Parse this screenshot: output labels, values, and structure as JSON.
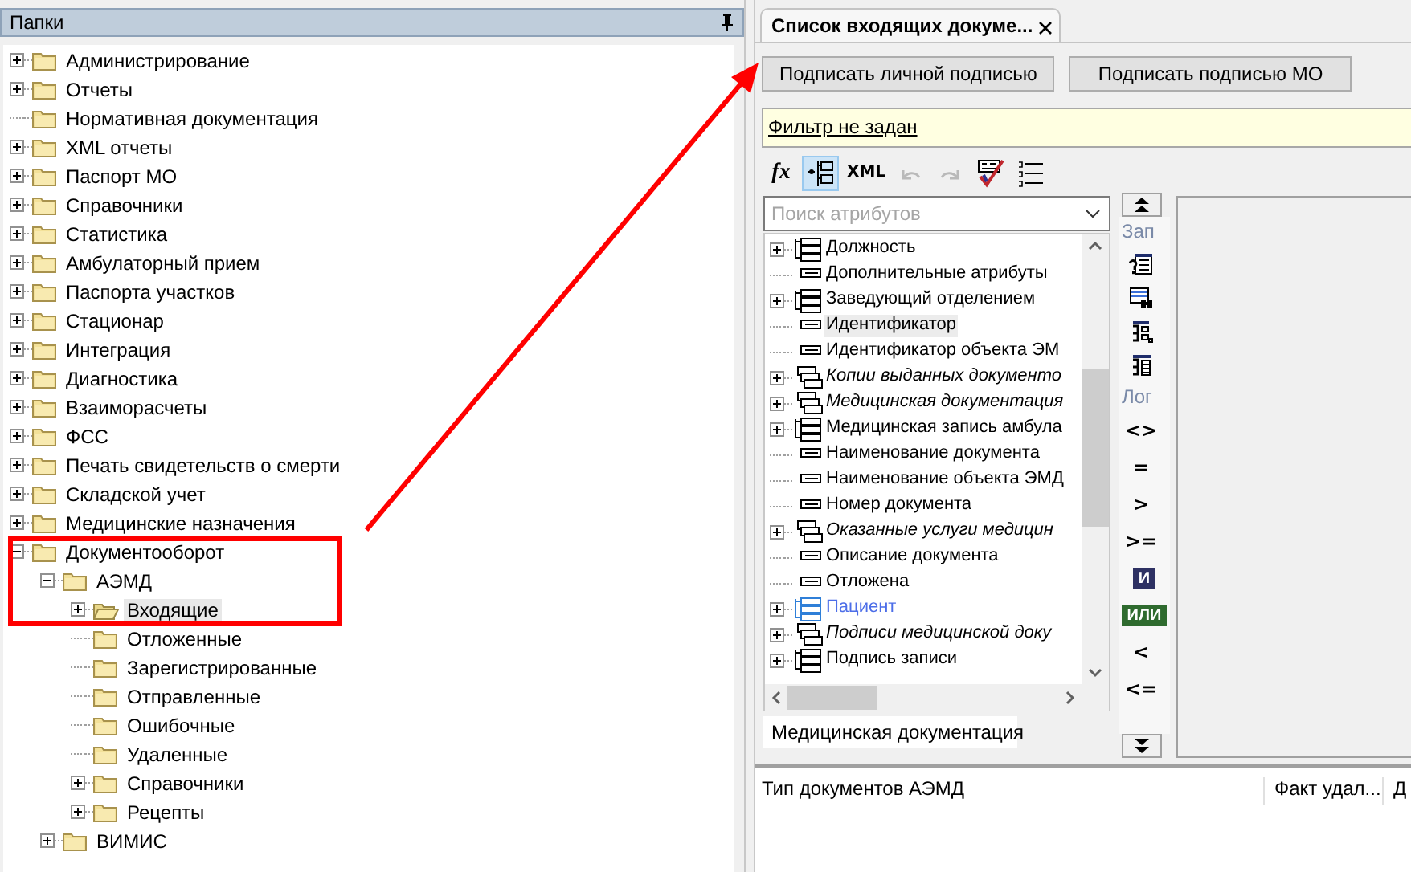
{
  "folders_panel": {
    "title": "Папки",
    "tree": [
      {
        "label": "Администрирование",
        "kind": "branch",
        "expanded": false,
        "selected": false
      },
      {
        "label": "Отчеты",
        "kind": "branch",
        "expanded": false,
        "selected": false
      },
      {
        "label": "Нормативная документация",
        "kind": "leaf",
        "selected": false
      },
      {
        "label": "XML отчеты",
        "kind": "branch",
        "expanded": false,
        "selected": false
      },
      {
        "label": "Паспорт МО",
        "kind": "branch",
        "expanded": false,
        "selected": false
      },
      {
        "label": "Справочники",
        "kind": "branch",
        "expanded": false,
        "selected": false
      },
      {
        "label": "Статистика",
        "kind": "branch",
        "expanded": false,
        "selected": false
      },
      {
        "label": "Амбулаторный прием",
        "kind": "branch",
        "expanded": false,
        "selected": false
      },
      {
        "label": "Паспорта участков",
        "kind": "branch",
        "expanded": false,
        "selected": false
      },
      {
        "label": "Стационар",
        "kind": "branch",
        "expanded": false,
        "selected": false
      },
      {
        "label": "Интеграция",
        "kind": "branch",
        "expanded": false,
        "selected": false
      },
      {
        "label": "Диагностика",
        "kind": "branch",
        "expanded": false,
        "selected": false
      },
      {
        "label": "Взаиморасчеты",
        "kind": "branch",
        "expanded": false,
        "selected": false
      },
      {
        "label": "ФСС",
        "kind": "branch",
        "expanded": false,
        "selected": false
      },
      {
        "label": "Печать свидетельств о смерти",
        "kind": "branch",
        "expanded": false,
        "selected": false
      },
      {
        "label": "Складской учет",
        "kind": "branch",
        "expanded": false,
        "selected": false
      },
      {
        "label": "Медицинские назначения",
        "kind": "branch",
        "expanded": false,
        "selected": false
      },
      {
        "label": "Документооборот",
        "kind": "branch",
        "expanded": true,
        "selected": false,
        "children": [
          {
            "label": "АЭМД",
            "kind": "branch",
            "expanded": true,
            "selected": false,
            "children": [
              {
                "label": "Входящие",
                "kind": "branch",
                "expanded": false,
                "selected": true
              },
              {
                "label": "Отложенные",
                "kind": "leaf",
                "selected": false
              },
              {
                "label": "Зарегистрированные",
                "kind": "leaf",
                "selected": false
              },
              {
                "label": "Отправленные",
                "kind": "leaf",
                "selected": false
              },
              {
                "label": "Ошибочные",
                "kind": "leaf",
                "selected": false
              },
              {
                "label": "Удаленные",
                "kind": "leaf",
                "selected": false
              },
              {
                "label": "Справочники",
                "kind": "branch",
                "expanded": false,
                "selected": false
              },
              {
                "label": "Рецепты",
                "kind": "branch",
                "expanded": false,
                "selected": false
              }
            ]
          },
          {
            "label": "ВИМИС",
            "kind": "branch",
            "expanded": false,
            "selected": false
          }
        ]
      }
    ]
  },
  "document_tab": {
    "title": "Список входящих докуме...",
    "selected": true
  },
  "buttons": [
    "Подписать личной подписью",
    "Подписать подписью МО"
  ],
  "filter": {
    "link": "Фильтр не задан"
  },
  "toolbar": [
    {
      "kind": "formula",
      "label": "fx"
    },
    {
      "kind": "tree",
      "selected": true
    },
    {
      "kind": "xml",
      "label": "XML"
    },
    {
      "kind": "undo",
      "disabled": true
    },
    {
      "kind": "redo",
      "disabled": true
    },
    {
      "kind": "check"
    },
    {
      "kind": "list"
    }
  ],
  "attribute_search": {
    "placeholder": "Поиск атрибутов"
  },
  "attributes": [
    {
      "label": "Должность",
      "kind": "group",
      "expandable": true,
      "selected": false
    },
    {
      "label": "Дополнительные атрибуты",
      "kind": "field",
      "expandable": false,
      "selected": false
    },
    {
      "label": "Заведующий отделением",
      "kind": "group",
      "expandable": true,
      "selected": false
    },
    {
      "label": "Идентификатор",
      "kind": "field",
      "expandable": false,
      "selected": true
    },
    {
      "label": "Идентификатор объекта ЭМ",
      "kind": "field",
      "expandable": false,
      "selected": false
    },
    {
      "label": "Копии выданных документо",
      "kind": "collection",
      "expandable": true,
      "selected": false
    },
    {
      "label": "Медицинская документация",
      "kind": "collection",
      "expandable": true,
      "selected": false
    },
    {
      "label": "Медицинская запись амбула",
      "kind": "group",
      "expandable": true,
      "selected": false
    },
    {
      "label": "Наименование документа",
      "kind": "field",
      "expandable": false,
      "selected": false
    },
    {
      "label": "Наименование объекта ЭМД",
      "kind": "field",
      "expandable": false,
      "selected": false
    },
    {
      "label": "Номер документа",
      "kind": "field",
      "expandable": false,
      "selected": false
    },
    {
      "label": "Оказанные услуги медицин",
      "kind": "collection",
      "expandable": true,
      "selected": false
    },
    {
      "label": "Описание документа",
      "kind": "field",
      "expandable": false,
      "selected": false
    },
    {
      "label": "Отложена",
      "kind": "field",
      "expandable": false,
      "selected": false
    },
    {
      "label": "Пациент",
      "kind": "reference",
      "expandable": true,
      "selected": false
    },
    {
      "label": "Подписи медицинской доку",
      "kind": "collection",
      "expandable": true,
      "selected": false
    },
    {
      "label": "Подпись записи",
      "kind": "group",
      "expandable": true,
      "selected": false
    }
  ],
  "attribute_tabs": [
    {
      "label": "Медицинская документация",
      "selected": true
    }
  ],
  "toolbox": {
    "sections": [
      {
        "label": "Зап",
        "items": [
          {
            "kind": "query"
          },
          {
            "kind": "table-search"
          },
          {
            "kind": "tree-table"
          },
          {
            "kind": "table"
          }
        ]
      },
      {
        "label": "Лог",
        "items": [
          {
            "kind": "operator",
            "label": "<>"
          },
          {
            "kind": "operator",
            "label": "="
          },
          {
            "kind": "operator",
            "label": ">"
          },
          {
            "kind": "operator",
            "label": ">="
          },
          {
            "kind": "badge",
            "label": "И",
            "color": "#2e3163"
          },
          {
            "kind": "badge",
            "label": "ИЛИ",
            "color": "#2f6b2f"
          },
          {
            "kind": "operator",
            "label": "<"
          },
          {
            "kind": "operator",
            "label": "<="
          }
        ]
      }
    ]
  },
  "grid": {
    "columns": [
      "Тип документов АЭМД",
      "Факт удал...",
      "Д"
    ]
  }
}
